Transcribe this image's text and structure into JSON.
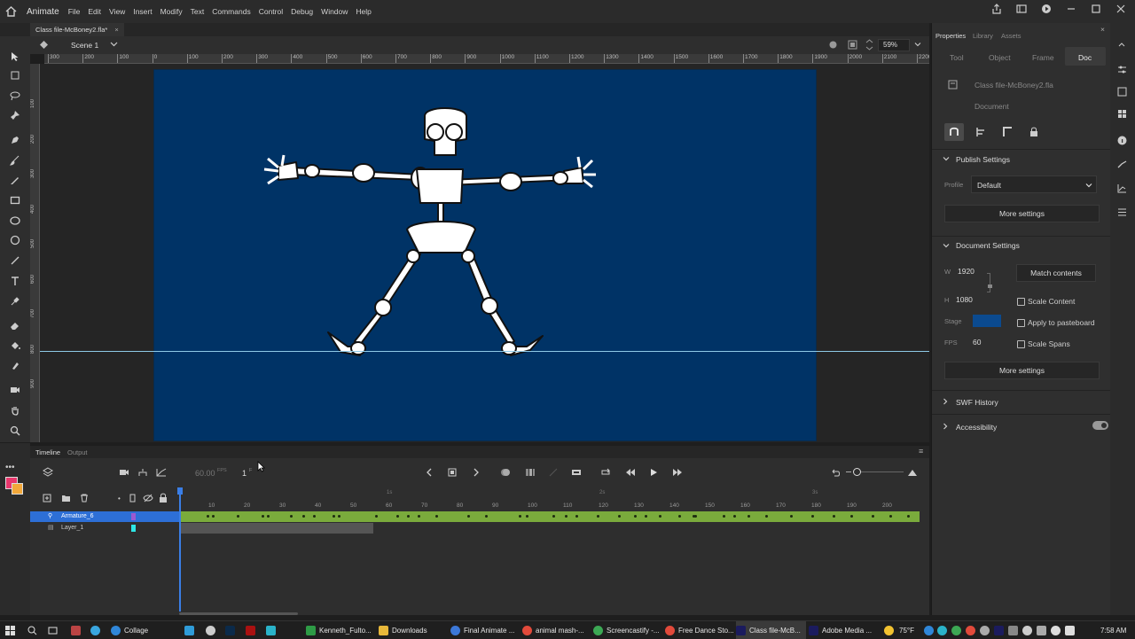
{
  "app": {
    "name": "Animate",
    "menus": [
      "File",
      "Edit",
      "View",
      "Insert",
      "Modify",
      "Text",
      "Commands",
      "Control",
      "Debug",
      "Window",
      "Help"
    ]
  },
  "document": {
    "tab_title": "Class file-McBoney2.fla*",
    "close_glyph": "×",
    "scene_label": "Scene 1",
    "zoom": "59%"
  },
  "ruler": {
    "top_ticks": [
      "300",
      "200",
      "100",
      "0",
      "100",
      "200",
      "300",
      "400",
      "500",
      "600",
      "700",
      "800",
      "900",
      "1000",
      "1100",
      "1200",
      "1300",
      "1400",
      "1500",
      "1600",
      "1700",
      "1800",
      "1900",
      "2000",
      "2100",
      "2200"
    ],
    "left_ticks": [
      "100",
      "200",
      "300",
      "400",
      "500",
      "600",
      "700",
      "800",
      "900"
    ]
  },
  "properties": {
    "panel_tabs": [
      "Properties",
      "Library",
      "Assets"
    ],
    "sub_tabs": [
      "Tool",
      "Object",
      "Frame",
      "Doc"
    ],
    "active_sub_tab": "Doc",
    "file_name": "Class file-McBoney2.fla",
    "doc_label": "Document",
    "publish": {
      "title": "Publish Settings",
      "profile_label": "Profile",
      "profile_value": "Default",
      "more_settings": "More settings"
    },
    "doc_settings": {
      "title": "Document Settings",
      "w_label": "W",
      "w_value": "1920",
      "h_label": "H",
      "h_value": "1080",
      "match_contents": "Match contents",
      "scale_content": "Scale Content",
      "stage_label": "Stage",
      "stage_color": "#003366",
      "apply_pasteboard": "Apply to pasteboard",
      "fps_label": "FPS",
      "fps_value": "60",
      "scale_spans": "Scale Spans",
      "more_settings": "More settings"
    },
    "swf_history": "SWF History",
    "accessibility": "Accessibility"
  },
  "timeline": {
    "tabs": [
      "Timeline",
      "Output"
    ],
    "fps_display": "60.00",
    "fps_unit": "FPS",
    "current_frame": "1",
    "frame_suffix": "F",
    "ruler_frames": [
      "10",
      "20",
      "30",
      "40",
      "50",
      "60",
      "70",
      "80",
      "90",
      "100",
      "110",
      "120",
      "130",
      "140",
      "150",
      "160",
      "170",
      "180",
      "190",
      "200"
    ],
    "seconds_marks": [
      "1s",
      "2s",
      "3s"
    ],
    "layers": [
      {
        "name": "Armature_6",
        "color": "#9b59d0",
        "selected": true
      },
      {
        "name": "Layer_1",
        "color": "#2ee6e6",
        "selected": false
      }
    ],
    "armature_span_color": "#7aab3c"
  },
  "taskbar": {
    "items": [
      {
        "label": "Collage",
        "color": "#2f86d8"
      },
      {
        "label": "Kenneth_Fulto...",
        "color": "#2e9b46"
      },
      {
        "label": "Downloads",
        "color": "#e8b83a"
      },
      {
        "label": "Final Animate ...",
        "color": "#3c78d8"
      },
      {
        "label": "animal mash-...",
        "color": "#e24a3b"
      },
      {
        "label": "Screencastify -...",
        "color": "#3ca854"
      },
      {
        "label": "Free Dance Sto...",
        "color": "#e24a3b"
      },
      {
        "label": "Class file-McB...",
        "color": "#1b1b5e"
      },
      {
        "label": "Adobe Media ...",
        "color": "#1b1b5e"
      }
    ],
    "temperature": "75°F",
    "time": "7:58 AM"
  },
  "colors": {
    "stage": "#003366",
    "guide": "#8ec9e6",
    "accent_blue": "#2d6fd6",
    "fill_swatch": "#e8376d",
    "stroke_swatch": "#f2a83a"
  }
}
